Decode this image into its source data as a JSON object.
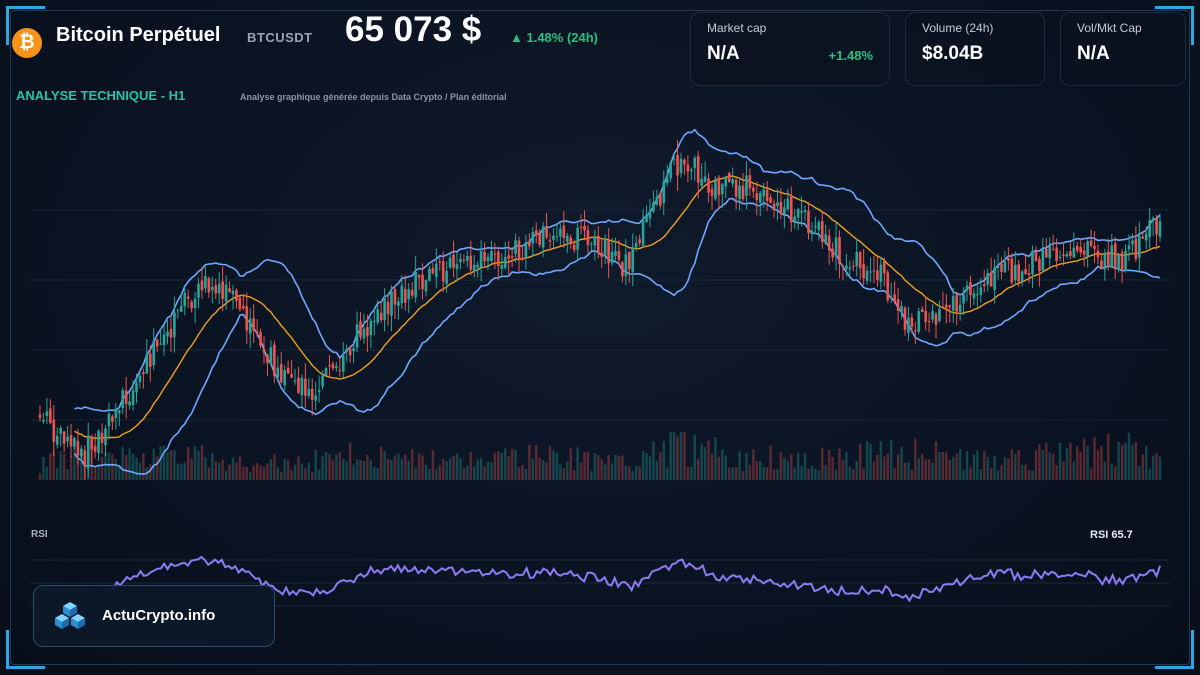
{
  "header": {
    "title": "Bitcoin Perpétuel",
    "ticker": "BTCUSDT",
    "price": "65 073 $",
    "change": "▲ 1.48% (24h)"
  },
  "section": {
    "label": "ANALYSE TECHNIQUE - H1",
    "subtitle": "Analyse graphique générée depuis Data Crypto / Plan éditorial"
  },
  "cards": [
    {
      "label": "Market cap",
      "value": "N/A",
      "change": "+1.48%"
    },
    {
      "label": "Volume (24h)",
      "value": "$8.04B",
      "change": ""
    },
    {
      "label": "Vol/Mkt Cap",
      "value": "N/A",
      "change": ""
    }
  ],
  "rsi": {
    "label": "RSI",
    "value_text": "RSI 65.7"
  },
  "brand": {
    "name": "ActuCrypto.info"
  },
  "icons": {
    "coin": "bitcoin-icon",
    "brand": "cubes-logo-icon"
  },
  "colors": {
    "background": "#0a1220",
    "up": "#26a69a",
    "down": "#ef5350",
    "bollinger": "#6fa8ff",
    "ma": "#f0a020",
    "rsi": "#8b7cf6",
    "accent": "#2ea6e0",
    "positive": "#26c281"
  },
  "chart_data": [
    {
      "type": "candlestick",
      "title": "ANALYSE TECHNIQUE - H1",
      "symbol": "BTCUSDT",
      "timeframe": "H1",
      "close_waypoints": [
        [
          0,
          60.0
        ],
        [
          5,
          56.0
        ],
        [
          12,
          53.0
        ],
        [
          20,
          58.0
        ],
        [
          30,
          66.0
        ],
        [
          40,
          75.0
        ],
        [
          48,
          80.0
        ],
        [
          56,
          77.0
        ],
        [
          64,
          70.0
        ],
        [
          72,
          64.0
        ],
        [
          80,
          63.5
        ],
        [
          90,
          70.0
        ],
        [
          100,
          76.0
        ],
        [
          110,
          80.0
        ],
        [
          120,
          82.0
        ],
        [
          130,
          82.5
        ],
        [
          140,
          85.0
        ],
        [
          150,
          87.0
        ],
        [
          160,
          86.0
        ],
        [
          170,
          82.0
        ],
        [
          180,
          93.0
        ],
        [
          186,
          99.0
        ],
        [
          195,
          95.0
        ],
        [
          205,
          94.0
        ],
        [
          215,
          92.0
        ],
        [
          225,
          88.0
        ],
        [
          235,
          83.0
        ],
        [
          245,
          80.0
        ],
        [
          250,
          74.0
        ],
        [
          257,
          73.0
        ],
        [
          265,
          77.0
        ],
        [
          275,
          80.0
        ],
        [
          285,
          82.0
        ],
        [
          295,
          85.0
        ],
        [
          305,
          84.0
        ],
        [
          315,
          83.0
        ],
        [
          320,
          86.0
        ],
        [
          325,
          89.0
        ]
      ],
      "volume_waypoints": [
        [
          0,
          0.12
        ],
        [
          15,
          0.25
        ],
        [
          30,
          0.18
        ],
        [
          45,
          0.2
        ],
        [
          60,
          0.15
        ],
        [
          75,
          0.14
        ],
        [
          90,
          0.22
        ],
        [
          110,
          0.17
        ],
        [
          130,
          0.16
        ],
        [
          150,
          0.21
        ],
        [
          170,
          0.15
        ],
        [
          185,
          0.3
        ],
        [
          200,
          0.2
        ],
        [
          220,
          0.18
        ],
        [
          240,
          0.24
        ],
        [
          255,
          0.22
        ],
        [
          275,
          0.17
        ],
        [
          295,
          0.2
        ],
        [
          315,
          0.26
        ],
        [
          325,
          0.2
        ]
      ],
      "series": [
        {
          "name": "Bollinger",
          "period": 20,
          "std": 2
        },
        {
          "name": "MA",
          "period": 20
        }
      ],
      "volume": true
    },
    {
      "type": "line",
      "title": "RSI",
      "period": 14,
      "last_value": 65.7,
      "ylim": [
        20,
        85
      ]
    }
  ]
}
